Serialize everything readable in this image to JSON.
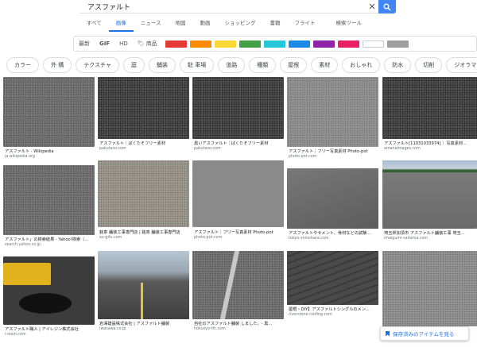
{
  "search": {
    "query": "アスファルト"
  },
  "tabs": [
    "すべて",
    "画像",
    "ニュース",
    "地図",
    "動画",
    "ショッピング",
    "書籍",
    "フライト",
    "検索ツール"
  ],
  "filters": {
    "latest": "最新",
    "gif": "GIF",
    "hd": "HD",
    "products": "商品"
  },
  "colors": [
    "#e53935",
    "#fb8c00",
    "#fdd835",
    "#43a047",
    "#26c6da",
    "#1e88e5",
    "#8e24aa",
    "#e91e63",
    "#ffffff",
    "#9e9e9e"
  ],
  "chips": [
    "カラー",
    "外 構",
    "テクスチャ",
    "庭",
    "舗装",
    "駐 車場",
    "道路",
    "種類",
    "屋根",
    "素材",
    "おしゃれ",
    "防水",
    "切削",
    "ジオラマ"
  ],
  "results": [
    {
      "caption": "アスファルト - Wikipedia",
      "source": "ja.wikipedia.org"
    },
    {
      "caption": "アスファルト｜ぱくたそフリー素材",
      "source": "pakutaso.com"
    },
    {
      "caption": "黒いアスファルト｜ぱくたそフリー素材",
      "source": "pakutaso.com"
    },
    {
      "caption": "アスファルト｜フリー写真素材 Photo-pot",
      "source": "photo-pot.com"
    },
    {
      "caption": "アスファルト[11031033974]｜ 写真素材...",
      "source": "amanaimages.com"
    },
    {
      "caption": "アスファルト」の検索結果 - Yahoo!検索（...",
      "source": "search.yahoo.co.jp"
    },
    {
      "caption": "銘阜 舗装工事専門店 | 銘阜 舗装工事専門店",
      "source": "ex-gifu.com"
    },
    {
      "caption": "アスファルト｜フリー写真素材 Photo-pot",
      "source": "photo-pot.com"
    },
    {
      "caption": "アスファルトやセメント、骨材などの試験...",
      "source": "tokyo-shinohara.com"
    },
    {
      "caption": "埼玉県加須市 アスファルト舗装工事 埼玉...",
      "source": "imaigumi-saitama.com"
    },
    {
      "caption": "アスファルト職人 | アイレジン株式会社",
      "source": "i-resin.com"
    },
    {
      "caption": "岩澤建設株式会社 | アスファルト舗装",
      "source": "iwasawa.co.jp"
    },
    {
      "caption": "自社のアスファルト舗装 しました。- 黒...",
      "source": "hokusyo-tfc.com"
    },
    {
      "caption": "屋根・DIY】アスファルトシングルのメン...",
      "source": "riverstone-roofing.com"
    },
    {
      "caption": "",
      "source": ""
    }
  ],
  "saved_button": "保存済みのアイテムを見る"
}
